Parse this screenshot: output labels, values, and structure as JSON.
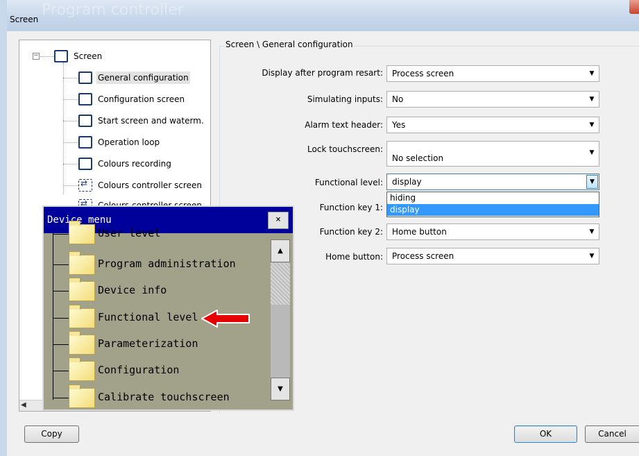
{
  "window": {
    "title": "Screen",
    "ghost_title": "Program controller"
  },
  "tree": {
    "root": "Screen",
    "items": [
      {
        "label": "General configuration"
      },
      {
        "label": "Configuration screen"
      },
      {
        "label": "Start screen and waterm."
      },
      {
        "label": "Operation loop"
      },
      {
        "label": "Colours recording"
      },
      {
        "label": "Colours controller screen"
      },
      {
        "label": "Colours controller screen"
      }
    ]
  },
  "form": {
    "group_title": "Screen \\ General configuration",
    "fields": [
      {
        "label": "Display after program resart:",
        "value": "Process screen"
      },
      {
        "label": "Simulating inputs:",
        "value": "No"
      },
      {
        "label": "Alarm text header:",
        "value": "Yes"
      },
      {
        "label": "Lock touchscreen:",
        "value": "No selection"
      },
      {
        "label": "Functional level:",
        "value": "display"
      },
      {
        "label": "Function key 1:",
        "value": ""
      },
      {
        "label": "Function key 2:",
        "value": "Home button"
      },
      {
        "label": "Home button:",
        "value": "Process screen"
      }
    ],
    "dropdown_options": [
      "hiding",
      "display"
    ],
    "dropdown_selected": "display"
  },
  "buttons": {
    "copy": "Copy",
    "ok": "OK",
    "cancel": "Cancel"
  },
  "device_menu": {
    "title": "Device menu",
    "close": "×",
    "items": [
      {
        "label": "User level"
      },
      {
        "label": "Program administration"
      },
      {
        "label": "Device info"
      },
      {
        "label": "Functional level"
      },
      {
        "label": "Parameterization"
      },
      {
        "label": "Configuration"
      },
      {
        "label": "Calibrate touchscreen"
      }
    ],
    "arrow_color": "#e60000",
    "title_color": "#00009b"
  },
  "icons": {
    "collapse": "−",
    "combo_arrow": "▼",
    "scroll_up": "▲",
    "scroll_down": "▼",
    "scroll_left": "◀"
  }
}
